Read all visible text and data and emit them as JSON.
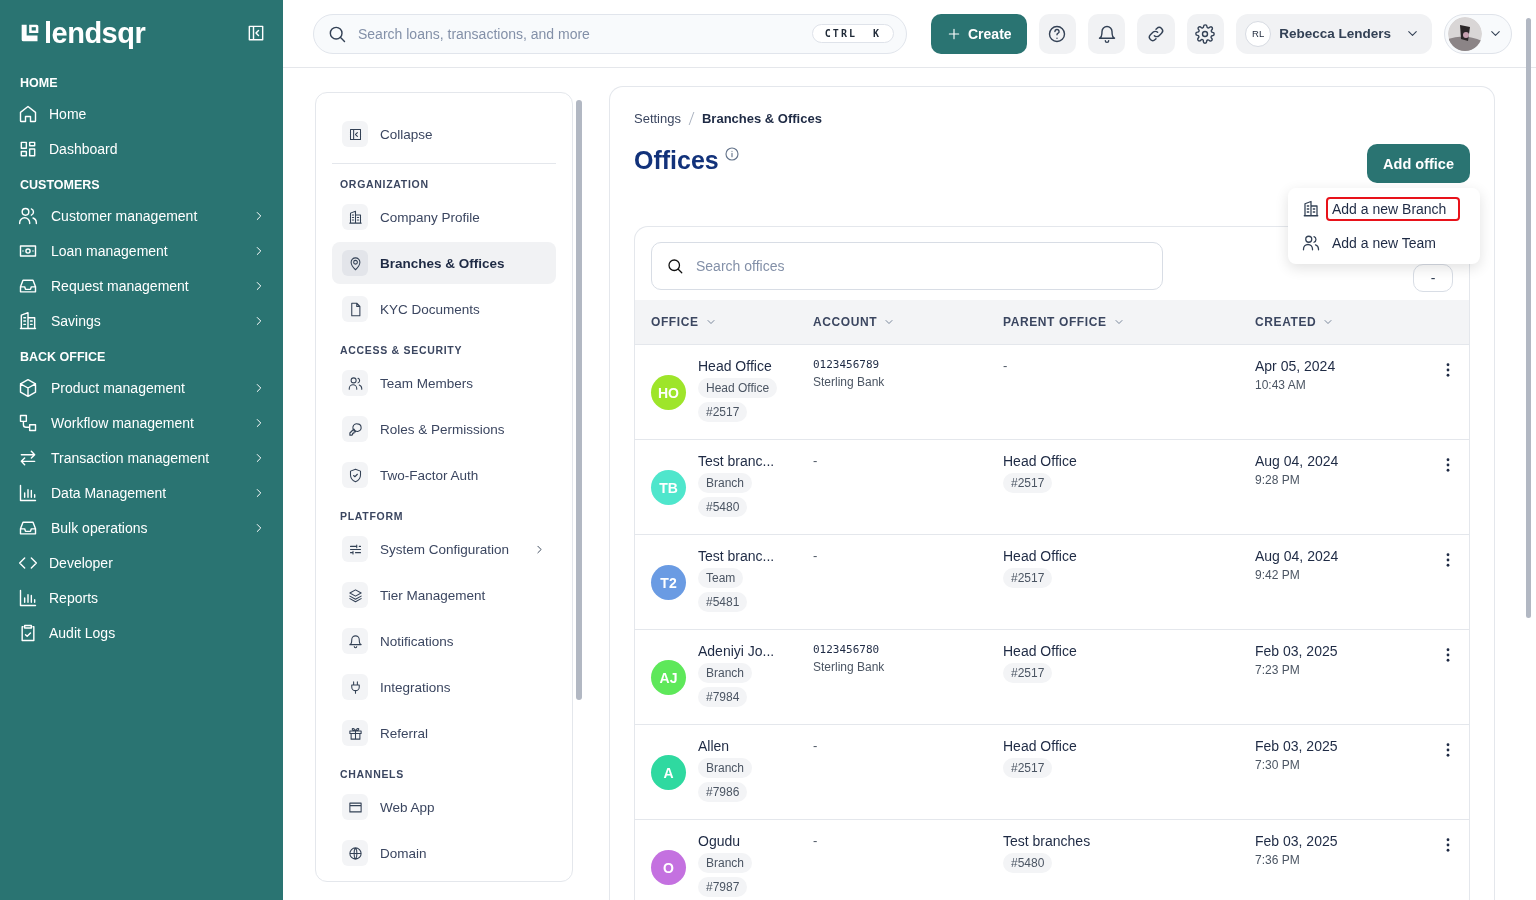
{
  "sidebar": {
    "logo": "lendsqr",
    "sections": [
      {
        "title": "HOME",
        "items": [
          {
            "label": "Home",
            "submenu": false
          },
          {
            "label": "Dashboard",
            "submenu": false
          }
        ]
      },
      {
        "title": "CUSTOMERS",
        "items": [
          {
            "label": "Customer management",
            "submenu": true
          },
          {
            "label": "Loan management",
            "submenu": true
          },
          {
            "label": "Request management",
            "submenu": true
          },
          {
            "label": "Savings",
            "submenu": true
          }
        ]
      },
      {
        "title": "BACK OFFICE",
        "items": [
          {
            "label": "Product management",
            "submenu": true
          },
          {
            "label": "Workflow management",
            "submenu": true
          },
          {
            "label": "Transaction management",
            "submenu": true
          },
          {
            "label": "Data Management",
            "submenu": true
          },
          {
            "label": "Bulk operations",
            "submenu": true
          },
          {
            "label": "Developer",
            "submenu": false
          },
          {
            "label": "Reports",
            "submenu": false
          },
          {
            "label": "Audit Logs",
            "submenu": false
          }
        ]
      }
    ]
  },
  "header": {
    "search_placeholder": "Search loans, transactions, and more",
    "shortcut": "CTRL  K",
    "create_button": "Create",
    "user": {
      "initials": "RL",
      "name": "Rebecca Lenders"
    }
  },
  "settings_menu": {
    "collapse": "Collapse",
    "sections": [
      {
        "title": "ORGANIZATION",
        "items": [
          {
            "label": "Company Profile",
            "selected": false,
            "submenu": false
          },
          {
            "label": "Branches & Offices",
            "selected": true,
            "submenu": false
          },
          {
            "label": "KYC Documents",
            "selected": false,
            "submenu": false
          }
        ]
      },
      {
        "title": "ACCESS & SECURITY",
        "items": [
          {
            "label": "Team Members",
            "selected": false,
            "submenu": false
          },
          {
            "label": "Roles & Permissions",
            "selected": false,
            "submenu": false
          },
          {
            "label": "Two-Factor Auth",
            "selected": false,
            "submenu": false
          }
        ]
      },
      {
        "title": "PLATFORM",
        "items": [
          {
            "label": "System Configuration",
            "selected": false,
            "submenu": true
          },
          {
            "label": "Tier Management",
            "selected": false,
            "submenu": false
          },
          {
            "label": "Notifications",
            "selected": false,
            "submenu": false
          },
          {
            "label": "Integrations",
            "selected": false,
            "submenu": false
          },
          {
            "label": "Referral",
            "selected": false,
            "submenu": false
          }
        ]
      },
      {
        "title": "CHANNELS",
        "items": [
          {
            "label": "Web App",
            "selected": false,
            "submenu": false
          },
          {
            "label": "Domain",
            "selected": false,
            "submenu": false
          }
        ]
      }
    ]
  },
  "breadcrumb": [
    "Settings",
    "Branches & Offices"
  ],
  "title": "Offices",
  "add_button": "Add office",
  "add_menu": [
    {
      "label": "Add a new Branch",
      "selected": true
    },
    {
      "label": "Add a new Team",
      "selected": false
    }
  ],
  "table": {
    "search_placeholder": "Search offices",
    "column_button": "-",
    "columns": [
      "OFFICE",
      "ACCOUNT",
      "PARENT OFFICE",
      "CREATED"
    ],
    "rows": [
      {
        "initials": "HO",
        "color": "#9ee52a",
        "name": "Head Office",
        "type": "Head Office",
        "code": "#2517",
        "account": {
          "number": "0123456789",
          "bank": "Sterling Bank"
        },
        "parent": null,
        "date": "Apr 05, 2024",
        "time": "10:43 AM"
      },
      {
        "initials": "TB",
        "color": "#4fe6cc",
        "name": "Test branc...",
        "type": "Branch",
        "code": "#5480",
        "account": null,
        "parent": {
          "name": "Head Office",
          "code": "#2517"
        },
        "date": "Aug 04, 2024",
        "time": "9:28 PM"
      },
      {
        "initials": "T2",
        "color": "#6a9be3",
        "name": "Test branc...",
        "type": "Team",
        "code": "#5481",
        "account": null,
        "parent": {
          "name": "Head Office",
          "code": "#2517"
        },
        "date": "Aug 04, 2024",
        "time": "9:42 PM"
      },
      {
        "initials": "AJ",
        "color": "#5ee85a",
        "name": "Adeniyi Jo...",
        "type": "Branch",
        "code": "#7984",
        "account": {
          "number": "0123456780",
          "bank": "Sterling Bank"
        },
        "parent": {
          "name": "Head Office",
          "code": "#2517"
        },
        "date": "Feb 03, 2025",
        "time": "7:23 PM"
      },
      {
        "initials": "A",
        "color": "#2fd9a0",
        "name": "Allen",
        "type": "Branch",
        "code": "#7986",
        "account": null,
        "parent": {
          "name": "Head Office",
          "code": "#2517"
        },
        "date": "Feb 03, 2025",
        "time": "7:30 PM"
      },
      {
        "initials": "O",
        "color": "#c471e0",
        "name": "Ogudu",
        "type": "Branch",
        "code": "#7987",
        "account": null,
        "parent": {
          "name": "Test branches",
          "code": "#5480"
        },
        "date": "Feb 03, 2025",
        "time": "7:36 PM"
      }
    ]
  },
  "empty_mark": "-"
}
